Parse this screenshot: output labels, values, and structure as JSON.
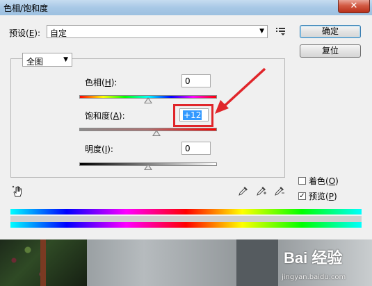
{
  "window": {
    "title": "色相/饱和度",
    "close_label": "✕"
  },
  "preset": {
    "label_prefix": "预设(",
    "label_key": "E",
    "label_suffix": "):",
    "value": "自定"
  },
  "buttons": {
    "ok": "确定",
    "reset": "复位"
  },
  "edit": {
    "value": "全图"
  },
  "hue": {
    "label_prefix": "色相(",
    "label_key": "H",
    "label_suffix": "):",
    "value": "0",
    "position": 0.5
  },
  "saturation": {
    "label_prefix": "饱和度(",
    "label_key": "A",
    "label_suffix": "):",
    "value": "+12",
    "position": 0.56
  },
  "lightness": {
    "label_prefix": "明度(",
    "label_key": "I",
    "label_suffix": "):",
    "value": "0",
    "position": 0.5
  },
  "colorize": {
    "label_prefix": "着色(",
    "label_key": "O",
    "label_suffix": ")",
    "checked": false
  },
  "preview": {
    "label_prefix": "预览(",
    "label_key": "P",
    "label_suffix": ")",
    "checked": true,
    "check_glyph": "✓"
  },
  "icons": {
    "preset_menu": "preset-options-icon",
    "hand": "targeted-adjustment-hand-icon",
    "eyedroppers": [
      "eyedropper-icon",
      "eyedropper-plus-icon",
      "eyedropper-minus-icon"
    ]
  },
  "watermark": {
    "brand": "Bai 经验",
    "url": "jingyan.baidu.com"
  },
  "colors": {
    "annotation": "#e0252a",
    "selection": "#3399ff"
  }
}
